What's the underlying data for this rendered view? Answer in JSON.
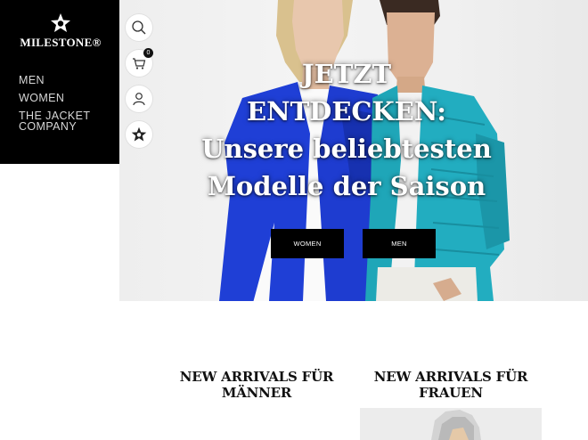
{
  "brand": {
    "name": "MILESTONE®"
  },
  "nav": {
    "items": [
      {
        "label": "MEN"
      },
      {
        "label": "WOMEN"
      },
      {
        "label_line1": "THE JACKET",
        "label_line2": "COMPANY"
      }
    ]
  },
  "icons": {
    "search": "search-icon",
    "cart": "cart-icon",
    "cart_count": "0",
    "account": "user-icon",
    "brand_star": "star-icon"
  },
  "hero": {
    "headline": "JETZT ENTDECKEN: Unsere beliebtesten Modelle der Saison",
    "buttons": [
      {
        "label": "WOMEN"
      },
      {
        "label": "MEN"
      }
    ]
  },
  "sections": {
    "men_title": "NEW ARRIVALS FÜR MÄNNER",
    "women_title": "NEW ARRIVALS FÜR FRAUEN"
  },
  "colors": {
    "sidebar_bg": "#000000",
    "woman_jacket": "#1f3fd6",
    "man_jacket": "#1fa6b8"
  }
}
